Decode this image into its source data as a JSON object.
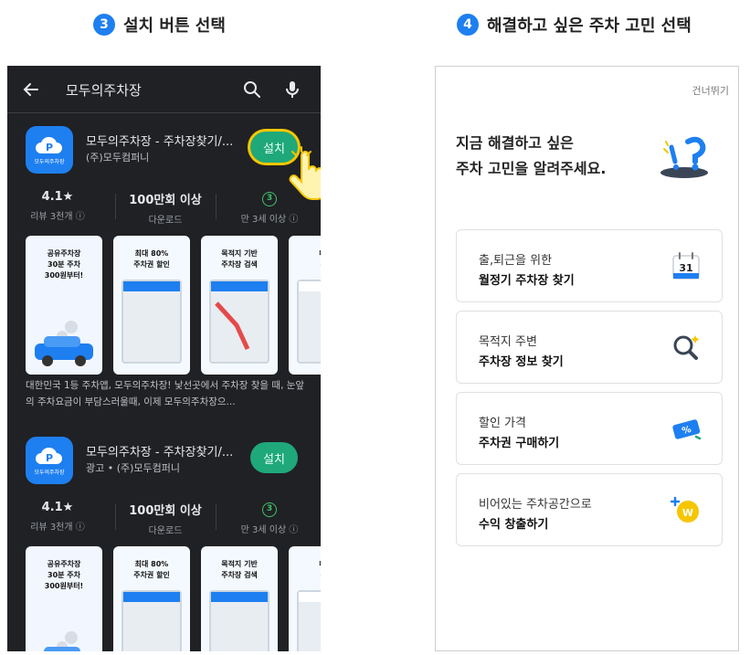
{
  "steps": {
    "left": {
      "number": "3",
      "title": "설치 버튼 선택"
    },
    "right": {
      "number": "4",
      "title": "해결하고 싶은 주차 고민 선택"
    }
  },
  "store": {
    "search_query": "모두의주차장",
    "icons": [
      "back-arrow-icon",
      "search-icon",
      "mic-icon"
    ],
    "apps": [
      {
        "title": "모두의주차장 - 주차장찾기/...",
        "developer": "(주)모두컴퍼니",
        "install": "설치",
        "icon_text": "모두의주차장",
        "rating": "4.1★",
        "reviews": "리뷰 3천개 ⓘ",
        "downloads_value": "100만회 이상",
        "downloads_label": "다운로드",
        "age_badge": "3",
        "age_label": "만 3세 이상 ⓘ"
      },
      {
        "title": "모두의주차장 - 주차장찾기/...",
        "developer": "광고 • (주)모두컴퍼니",
        "install": "설치",
        "icon_text": "모두의주차장",
        "rating": "4.1★",
        "reviews": "리뷰 3천개 ⓘ",
        "downloads_value": "100만회 이상",
        "downloads_label": "다운로드",
        "age_badge": "3",
        "age_label": "만 3세 이상 ⓘ"
      }
    ],
    "screenshots": [
      {
        "caption": "공유주차장\n30분 주차\n300원부터!"
      },
      {
        "caption": "최대 80%\n주차권 할인"
      },
      {
        "caption": "목적지 기반\n주차장 검색"
      },
      {
        "caption": "내 주\n유료"
      }
    ],
    "description": "대한민국 1등 주차앱, 모두의주차장! 낯선곳에서 주차장 찾을 때, 눈앞의 주차요금이 부담스러울때, 이제 모두의주차장으..."
  },
  "onboarding": {
    "skip": "건너뛰기",
    "headline_line1": "지금 해결하고 싶은",
    "headline_line2": "주차 고민을 알려주세요.",
    "options": [
      {
        "line1": "출,퇴근을 위한",
        "line2": "월정기 주차장 찾기",
        "icon": "calendar-icon",
        "icon_text": "31"
      },
      {
        "line1": "목적지 주변",
        "line2": "주차장 정보 찾기",
        "icon": "magnifier-icon",
        "icon_text": ""
      },
      {
        "line1": "할인 가격",
        "line2": "주차권 구매하기",
        "icon": "discount-ticket-icon",
        "icon_text": "%"
      },
      {
        "line1": "비어있는 주차공간으로",
        "line2": "수익 창출하기",
        "icon": "coin-icon",
        "icon_text": "W"
      }
    ]
  },
  "colors": {
    "accent": "#1e7ff0",
    "install_green": "#1fa87a",
    "highlight": "#f6c600"
  }
}
